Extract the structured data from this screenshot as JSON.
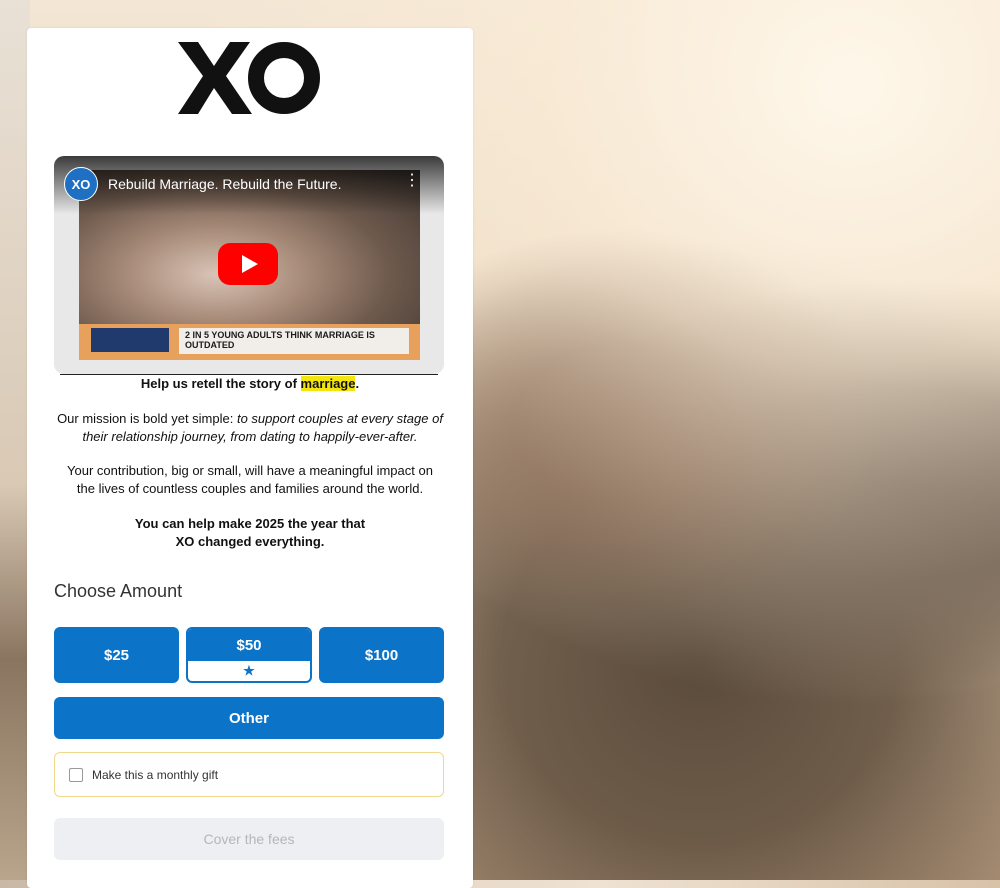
{
  "brand": {
    "logo_text": "XO",
    "accent_color": "#0b74c8",
    "highlight_color": "#f5e50f"
  },
  "video": {
    "channel_icon_text": "XO",
    "title": "Rebuild Marriage. Rebuild the Future.",
    "menu_icon": "more-vertical-icon",
    "caption": "2 IN 5 YOUNG ADULTS THINK MARRIAGE IS OUTDATED",
    "play_icon": "youtube-play-icon"
  },
  "intro": {
    "headline_prefix": "Help us retell the story of ",
    "headline_highlight": "marriage",
    "headline_suffix": ".",
    "mission_prefix": "Our mission is bold yet simple: ",
    "mission_italic": "to support couples at every stage of their relationship journey, from dating to happily-ever-after.",
    "impact": "Your contribution, big or small, will have a meaningful impact on the lives of countless couples and families around the world.",
    "cta_line1": "You can help make 2025 the year that",
    "cta_line2": "XO changed everything."
  },
  "donation": {
    "heading": "Choose Amount",
    "amounts": [
      {
        "label": "$25",
        "selected": false
      },
      {
        "label": "$50",
        "selected": true
      },
      {
        "label": "$100",
        "selected": false
      }
    ],
    "selected_icon": "star-icon",
    "other_label": "Other",
    "monthly_label": "Make this a monthly gift",
    "monthly_checked": false,
    "fees_label": "Cover the fees"
  }
}
